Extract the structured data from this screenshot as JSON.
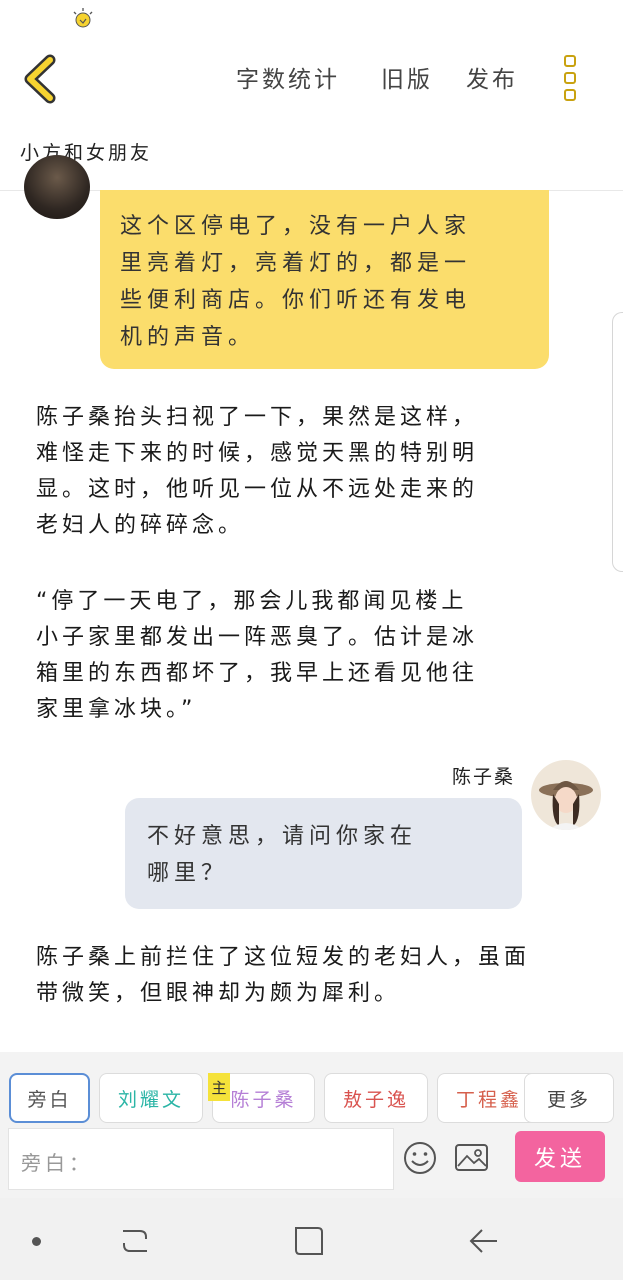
{
  "status": {
    "icon": "bulb-notification-icon"
  },
  "header": {
    "back_icon": "chevron-left-icon",
    "word_count": "字数统计",
    "old_version": "旧版",
    "publish": "发布",
    "more_icon": "vertical-dots-menu-icon",
    "accent": "#c9a210"
  },
  "story_title": "小方和女朋友",
  "chat": {
    "bubble_top": {
      "lines": [
        "这个区停电了，没有一户人家",
        "里亮着灯，亮着灯的，都是一",
        "些便利商店。你们听还有发电",
        "机的声音。"
      ],
      "color": "#fbdd6c"
    },
    "narration_1": [
      "陈子桑抬头扫视了一下，果然是这样，",
      "难怪走下来的时候，感觉天黑的特别明",
      "显。这时，他听见一位从不远处走来的",
      "老妇人的碎碎念。"
    ],
    "narration_2": [
      "“停了一天电了，那会儿我都闻见楼上",
      "小子家里都发出一阵恶臭了。估计是冰",
      "箱里的东西都坏了，我早上还看见他往",
      "家里拿冰块。”"
    ],
    "speaker": "陈子桑",
    "bubble_right": {
      "lines": [
        "不好意思，请问你家在",
        "哪里？"
      ],
      "color": "#e3e7ef"
    },
    "narration_3": [
      "陈子桑上前拦住了这位短发的老妇人，虽面",
      "带微笑，但眼神却为颇为犀利。"
    ]
  },
  "composer": {
    "roles": [
      {
        "label": "旁白",
        "color": "#555555"
      },
      {
        "label": "刘耀文",
        "color": "#2bb5a6"
      },
      {
        "label": "陈子桑",
        "color": "#b57fd6"
      },
      {
        "label": "敖子逸",
        "color": "#d9534f"
      },
      {
        "label": "丁程鑫",
        "color": "#d6604d"
      },
      {
        "label": "更多",
        "color": "#444444"
      }
    ],
    "main_tag": "主",
    "input_placeholder": "旁白：",
    "emoji_icon": "smiley-icon",
    "image_icon": "image-icon",
    "send": "发送",
    "send_color": "#f3649f"
  },
  "navbar": {
    "dot_icon": "dot-icon",
    "recent_icon": "recent-apps-icon",
    "home_icon": "home-square-icon",
    "back_icon": "back-arrow-icon"
  }
}
